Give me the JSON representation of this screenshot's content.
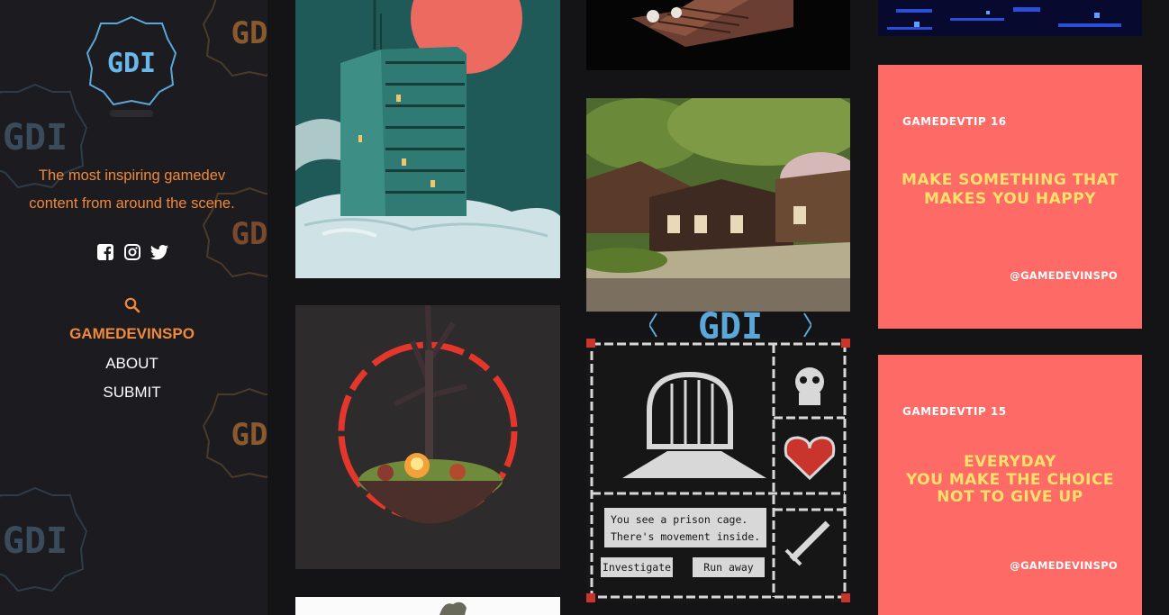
{
  "sidebar": {
    "logo_text": "GDI",
    "tagline_line1": "The most inspiring gamedev",
    "tagline_line2": "content from around the scene.",
    "social": [
      "facebook-icon",
      "instagram-icon",
      "twitter-icon"
    ],
    "nav": [
      {
        "label": "GAMEDEVINSPO",
        "active": true
      },
      {
        "label": "ABOUT",
        "active": false
      },
      {
        "label": "SUBMIT",
        "active": false
      }
    ]
  },
  "posts": {
    "tip16": {
      "number": "GAMEDEVTIP 16",
      "line1": "MAKE SOMETHING THAT",
      "line2": "MAKES YOU HAPPY",
      "handle": "@GAMEDEVINSPO"
    },
    "tip15": {
      "number": "GAMEDEVTIP 15",
      "line1": "EVERYDAY",
      "line2": "YOU MAKE THE CHOICE",
      "line3": "NOT TO GIVE UP",
      "handle": "@GAMEDEVINSPO"
    },
    "dungeon": {
      "line1": "You see a prison cage.",
      "line2": "There's movement inside.",
      "action1": "Investigate",
      "action2": "Run away"
    }
  },
  "colors": {
    "accent": "#f08a3a",
    "tip_bg": "#fe6a66",
    "tip_text": "#ffe06b"
  }
}
